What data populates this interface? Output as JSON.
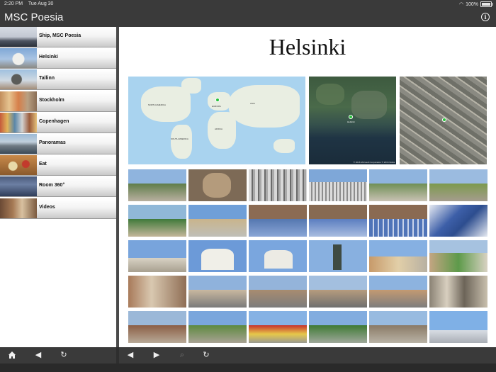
{
  "status": {
    "time": "2:20 PM",
    "date": "Tue Aug 30",
    "battery": "100%",
    "battery_level": 1.0,
    "wifi_icon": "wifi-icon"
  },
  "app": {
    "title": "MSC Poesia",
    "info_icon": "info-icon"
  },
  "sidebar": {
    "items": [
      {
        "label": "Ship, MSC Poesia"
      },
      {
        "label": "Helsinki"
      },
      {
        "label": "Tallinn"
      },
      {
        "label": "Stockholm"
      },
      {
        "label": "Copenhagen"
      },
      {
        "label": "Panoramas"
      },
      {
        "label": "Eat"
      },
      {
        "label": "Room 360°"
      },
      {
        "label": "Videos"
      }
    ]
  },
  "main": {
    "title": "Helsinki",
    "world_map_labels": [
      "NORTH AMERICA",
      "EUROPE",
      "ASIA",
      "AFRICA",
      "SOUTH AMERICA"
    ],
    "satellite_label": "Helsinki",
    "copyright": "© 2016 Microsoft Corporation © 2016 Nokia"
  },
  "toolbar": {
    "left": [
      "home-icon",
      "back-icon",
      "reload-icon"
    ],
    "right": [
      "back-icon",
      "forward-icon",
      "search-icon",
      "reload-icon"
    ]
  },
  "colors": {
    "chrome": "#3a3a3a",
    "water": "#a9d3ef",
    "pin": "#27c23a"
  }
}
